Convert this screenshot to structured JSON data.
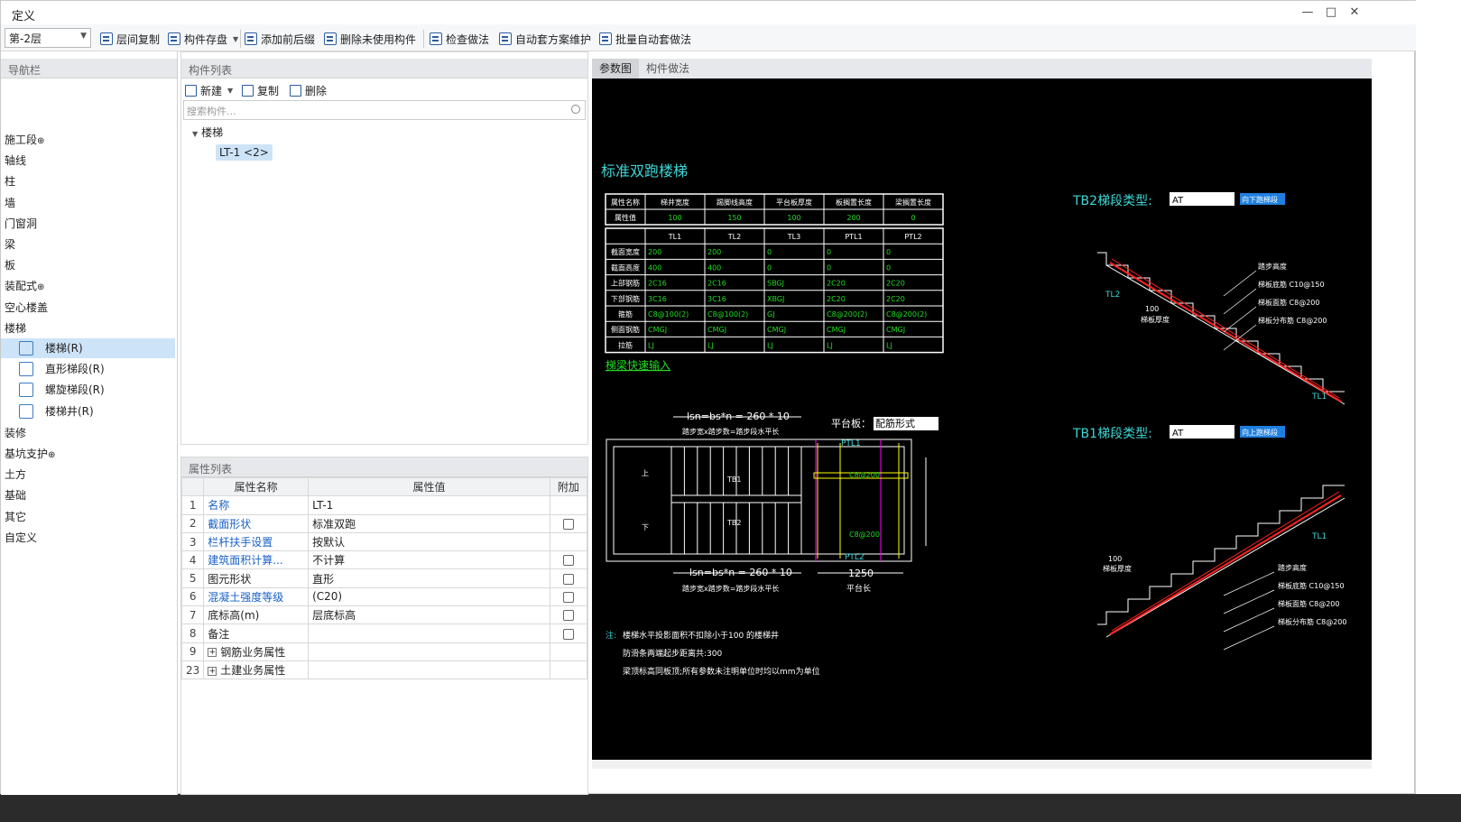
{
  "window": {
    "title": "定义"
  },
  "toolbar": {
    "floor": "第-2层",
    "items": [
      "层间复制",
      "构件存盘",
      "添加前后缀",
      "删除未使用构件",
      "检查做法",
      "自动套方案维护",
      "批量自动套做法"
    ]
  },
  "nav": {
    "header": "导航栏",
    "items": [
      "施工段",
      "轴线",
      "柱",
      "墙",
      "门窗洞",
      "梁",
      "板",
      "装配式",
      "空心楼盖",
      "楼梯"
    ],
    "sub": [
      "楼梯(R)",
      "直形梯段(R)",
      "螺旋梯段(R)",
      "楼梯井(R)"
    ],
    "items2": [
      "装修",
      "基坑支护",
      "土方",
      "基础",
      "其它",
      "自定义"
    ]
  },
  "components": {
    "header": "构件列表",
    "new": "新建",
    "copy": "复制",
    "delete": "删除",
    "search_placeholder": "搜索构件...",
    "tree_root": "楼梯",
    "tree_item": "LT-1 <2>"
  },
  "properties": {
    "header": "属性列表",
    "col_name": "属性名称",
    "col_value": "属性值",
    "col_extra": "附加",
    "rows": [
      {
        "no": "1",
        "name": "名称",
        "value": "LT-1"
      },
      {
        "no": "2",
        "name": "截面形状",
        "value": "标准双跑"
      },
      {
        "no": "3",
        "name": "栏杆扶手设置",
        "value": "按默认"
      },
      {
        "no": "4",
        "name": "建筑面积计算...",
        "value": "不计算"
      },
      {
        "no": "5",
        "name": "图元形状",
        "value": "直形"
      },
      {
        "no": "6",
        "name": "混凝土强度等级",
        "value": "(C20)"
      },
      {
        "no": "7",
        "name": "底标高(m)",
        "value": "层底标高"
      },
      {
        "no": "8",
        "name": "备注",
        "value": ""
      },
      {
        "no": "9",
        "name": "钢筋业务属性",
        "value": ""
      },
      {
        "no": "23",
        "name": "土建业务属性",
        "value": ""
      }
    ]
  },
  "cad_tabs": [
    "参数图",
    "构件做法"
  ],
  "cad": {
    "title": "标准双跑楼梯",
    "t1_headers": [
      "属性名称",
      "梯井宽度",
      "踢脚线高度",
      "平台板厚度",
      "板搁置长度",
      "梁搁置长度"
    ],
    "t1_values": [
      "属性值",
      "100",
      "150",
      "100",
      "200",
      "0"
    ],
    "t2_headers": [
      "",
      "TL1",
      "TL2",
      "TL3",
      "PTL1",
      "PTL2"
    ],
    "t2_rows": [
      [
        "截面宽度",
        "200",
        "200",
        "0",
        "0",
        "0"
      ],
      [
        "截面高度",
        "400",
        "400",
        "0",
        "0",
        "0"
      ],
      [
        "上部钢筋",
        "2C16",
        "2C16",
        "SBGJ",
        "2C20",
        "2C20"
      ],
      [
        "下部钢筋",
        "3C16",
        "3C16",
        "XBGJ",
        "2C20",
        "2C20"
      ],
      [
        "箍筋",
        "C8@100(2)",
        "C8@100(2)",
        "GJ",
        "C8@200(2)",
        "C8@200(2)"
      ],
      [
        "侧面钢筋",
        "CMGJ",
        "CMGJ",
        "CMGJ",
        "CMGJ",
        "CMGJ"
      ],
      [
        "拉筋",
        "LJ",
        "LJ",
        "LJ",
        "LJ",
        "LJ"
      ]
    ],
    "quick_input": "梯梁快速输入",
    "plan_top": "lsn=bs*n = 260 * 10",
    "plan_top_sub": "踏步宽x踏步数=踏步段水平长",
    "platform_label": "平台板：",
    "platform_value": "配筋形式",
    "plan_bottom": "lsn=bs*n = 260 * 10",
    "plan_bottom_sub": "踏步宽x踏步数=踏步段水平长",
    "platform_len": "1250",
    "platform_len_sub": "平台长",
    "tb2_label": "TB2梯段类型:",
    "tb2_value": "AT",
    "tb2_btn": "向下跑梯段",
    "tb1_label": "TB1梯段类型:",
    "tb1_value": "AT",
    "tb1_btn": "向上跑梯段",
    "note_prefix": "注:",
    "note1": "楼梯水平投影面积不扣除小于100 的楼梯井",
    "note2": "防滑条两端起步距离共:300",
    "note3": "梁顶标高同板顶;所有参数未注明单位时均以mm为单位",
    "tb2_labels": [
      "踏步高度",
      "梯板底筋 C10@150",
      "梯板面筋 C8@200",
      "梯板分布筋 C8@200",
      "100",
      "梯板厚度",
      "TL2",
      "TL1"
    ],
    "tb1_labels": [
      "踏步高度",
      "梯板底筋 C10@150",
      "梯板面筋 C8@200",
      "梯板分布筋 C8@200",
      "100",
      "梯板厚度",
      "TL1"
    ]
  }
}
